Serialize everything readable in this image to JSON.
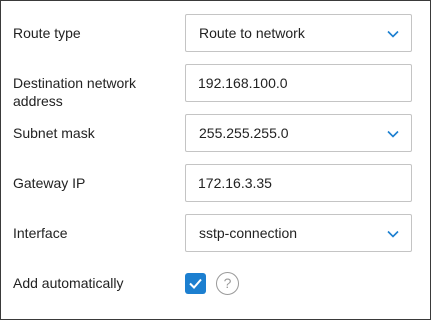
{
  "form": {
    "route_type": {
      "label": "Route type",
      "value": "Route to network",
      "icon": "chevron-down-icon"
    },
    "destination": {
      "label": "Destination network address",
      "value": "192.168.100.0"
    },
    "subnet_mask": {
      "label": "Subnet mask",
      "value": "255.255.255.0",
      "icon": "chevron-down-icon"
    },
    "gateway": {
      "label": "Gateway IP",
      "value": "172.16.3.35"
    },
    "interface": {
      "label": "Interface",
      "value": "sstp-connection",
      "icon": "chevron-down-icon"
    },
    "add_automatically": {
      "label": "Add automatically",
      "checked": true,
      "help_icon": "?"
    }
  },
  "colors": {
    "accent": "#1c7fd0",
    "border": "#c4c4c4",
    "text": "#222222"
  }
}
